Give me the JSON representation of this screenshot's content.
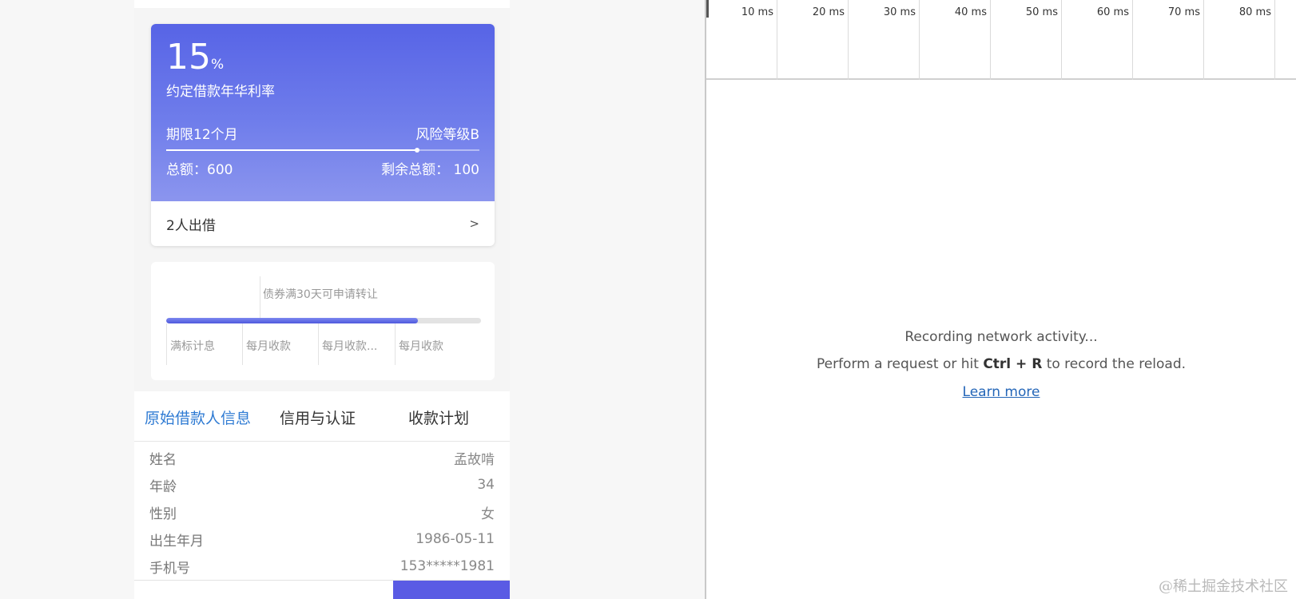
{
  "loan": {
    "rate_value": "15",
    "rate_unit": "%",
    "rate_label": "约定借款年华利率",
    "term": "期限12个月",
    "risk": "风险等级B",
    "progress": 0.8,
    "total": "总额：600",
    "remaining": "剩余总额：  100",
    "investors": "2人出借",
    "investors_chevron": ">"
  },
  "timeline": {
    "note": "债券满30天可申请转让",
    "progress": 0.8,
    "steps": [
      "满标计息",
      "每月收款",
      "每月收款...",
      "每月收款"
    ]
  },
  "tabs": [
    "原始借款人信息",
    "信用与认证",
    "收款计划"
  ],
  "active_tab": 0,
  "borrower": [
    {
      "label": "姓名",
      "value": "孟故啃"
    },
    {
      "label": "年龄",
      "value": "34"
    },
    {
      "label": "性别",
      "value": "女"
    },
    {
      "label": "出生年月",
      "value": "1986-05-11"
    },
    {
      "label": "手机号",
      "value": "153*****1981"
    }
  ],
  "devtools": {
    "ticks": [
      "10 ms",
      "20 ms",
      "30 ms",
      "40 ms",
      "50 ms",
      "60 ms",
      "70 ms",
      "80 ms"
    ],
    "recording": "Recording network activity...",
    "hint_before": "Perform a request or hit ",
    "hint_keys": "Ctrl + R",
    "hint_after": " to record the reload.",
    "learn_more": "Learn more"
  },
  "watermark": "@稀土掘金技术社区"
}
